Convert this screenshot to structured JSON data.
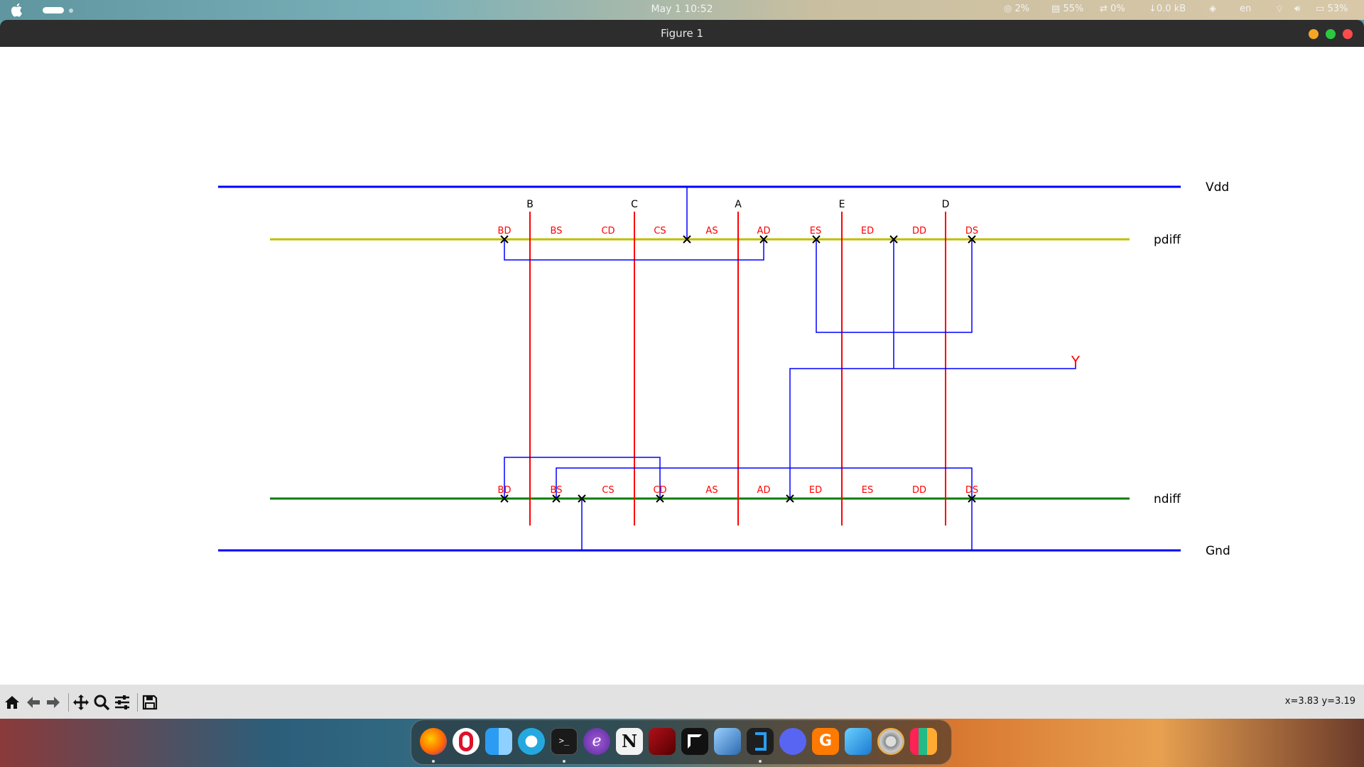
{
  "menubar": {
    "clock": "May 1  10:52",
    "cpu": "2%",
    "mem": "55%",
    "swap": "0%",
    "net": "0.0 kB",
    "lang": "en",
    "battery": "53%"
  },
  "window": {
    "title": "Figure 1"
  },
  "diagram": {
    "rails": {
      "top": "Vdd",
      "bottom": "Gnd"
    },
    "diffusions": {
      "p": "pdiff",
      "n": "ndiff"
    },
    "gates": [
      "B",
      "C",
      "A",
      "E",
      "D"
    ],
    "pdiff_terminals": [
      "BD",
      "BS",
      "CD",
      "CS",
      "AS",
      "AD",
      "ES",
      "ED",
      "DD",
      "DS"
    ],
    "ndiff_terminals": [
      "BD",
      "BS",
      "CS",
      "CD",
      "AS",
      "AD",
      "ED",
      "ES",
      "DD",
      "DS"
    ],
    "output": "Y",
    "colors": {
      "rail": "#0000ff",
      "pdiff": "#bfbf00",
      "ndiff": "#008000",
      "gate": "#ff0000",
      "wire": "#0000ff",
      "label": "#ff0000"
    }
  },
  "toolbar": {
    "icons": [
      "home-icon",
      "back-icon",
      "forward-icon",
      "pan-icon",
      "zoom-icon",
      "configure-icon",
      "save-icon"
    ],
    "coords": "x=3.83 y=3.19"
  },
  "dock": {
    "apps": [
      "Firefox",
      "Opera",
      "Finder",
      "Safari",
      "Terminal",
      "Emacs",
      "Notion",
      "FileZilla",
      "Cursor",
      "Xcode",
      "VS Code",
      "Discord",
      "Grammarly",
      "VirtualBox",
      "System Preferences",
      "Launchpad"
    ]
  }
}
